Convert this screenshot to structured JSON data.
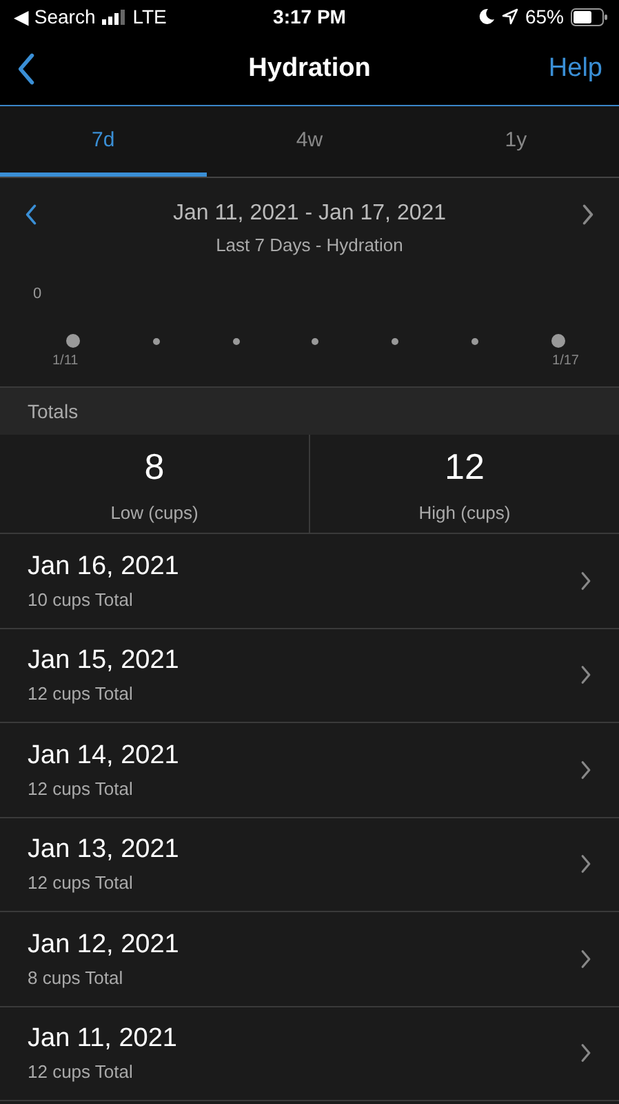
{
  "status_bar": {
    "back_label": "◀ Search",
    "network": "LTE",
    "time": "3:17 PM",
    "battery": "65%"
  },
  "nav": {
    "title": "Hydration",
    "action": "Help"
  },
  "tabs": [
    {
      "label": "7d",
      "selected": true
    },
    {
      "label": "4w",
      "selected": false
    },
    {
      "label": "1y",
      "selected": false
    }
  ],
  "range": {
    "dates": "Jan 11, 2021 - Jan 17, 2021",
    "subtitle": "Last 7 Days - Hydration",
    "prev_enabled": true,
    "next_enabled": false
  },
  "chart": {
    "y_label": "0",
    "x_labels": [
      "1/11",
      "1/17"
    ],
    "points": [
      {
        "large": true
      },
      {
        "large": false
      },
      {
        "large": false
      },
      {
        "large": false
      },
      {
        "large": false
      },
      {
        "large": false
      },
      {
        "large": true
      }
    ]
  },
  "totals": {
    "header": "Totals",
    "stats": [
      {
        "value": "8",
        "label": "Low (cups)"
      },
      {
        "value": "12",
        "label": "High (cups)"
      }
    ]
  },
  "days": [
    {
      "date": "Jan 16, 2021",
      "total": "10 cups Total"
    },
    {
      "date": "Jan 15, 2021",
      "total": "12 cups Total"
    },
    {
      "date": "Jan 14, 2021",
      "total": "12 cups Total"
    },
    {
      "date": "Jan 13, 2021",
      "total": "12 cups Total"
    },
    {
      "date": "Jan 12, 2021",
      "total": "8 cups Total"
    },
    {
      "date": "Jan 11, 2021",
      "total": "12 cups Total"
    }
  ]
}
